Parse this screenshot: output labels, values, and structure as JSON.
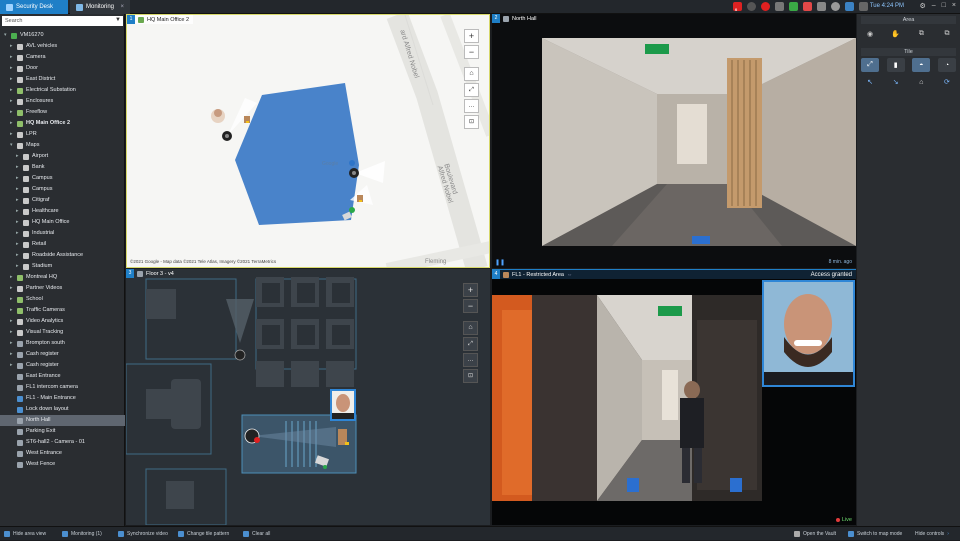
{
  "topbar": {
    "app_tab": "Security Desk",
    "monitoring_tab": "Monitoring",
    "clock": "Tue 4:24 PM",
    "tray_icons": [
      "alarm-icon",
      "clock-icon",
      "record-icon",
      "camera-icon",
      "network-icon",
      "health-icon",
      "volume-icon",
      "user-icon",
      "monitor-icon",
      "keyboard-icon",
      "settings-icon"
    ],
    "tray_badge": "0"
  },
  "sidebar": {
    "search_placeholder": "Search",
    "items": [
      {
        "label": "VM16270",
        "level": 0,
        "icon": "system-icon",
        "color": "#4caf50",
        "exp": "▾"
      },
      {
        "label": "AVL vehicles",
        "level": 1,
        "icon": "folder-icon",
        "color": "#c9c9c9",
        "exp": "▸"
      },
      {
        "label": "Camera",
        "level": 1,
        "icon": "folder-icon",
        "color": "#c9c9c9",
        "exp": "▸"
      },
      {
        "label": "Door",
        "level": 1,
        "icon": "folder-icon",
        "color": "#c9c9c9",
        "exp": "▸"
      },
      {
        "label": "East District",
        "level": 1,
        "icon": "folder-icon",
        "color": "#c9c9c9",
        "exp": "▸"
      },
      {
        "label": "Electrical Substation",
        "level": 1,
        "icon": "map-icon",
        "color": "#8fbf6a",
        "exp": "▸"
      },
      {
        "label": "Enclosures",
        "level": 1,
        "icon": "folder-icon",
        "color": "#c9c9c9",
        "exp": "▸"
      },
      {
        "label": "Freeflow",
        "level": 1,
        "icon": "map-icon",
        "color": "#8fbf6a",
        "exp": "▸"
      },
      {
        "label": "HQ Main Office 2",
        "level": 1,
        "icon": "map-icon",
        "color": "#8fbf6a",
        "exp": "▸",
        "bold": true
      },
      {
        "label": "LPR",
        "level": 1,
        "icon": "folder-icon",
        "color": "#c9c9c9",
        "exp": "▸"
      },
      {
        "label": "Maps",
        "level": 1,
        "icon": "folder-icon",
        "color": "#c9c9c9",
        "exp": "▾"
      },
      {
        "label": "Airport",
        "level": 2,
        "icon": "map-icon",
        "color": "#c9c9c9",
        "exp": "▸"
      },
      {
        "label": "Bank",
        "level": 2,
        "icon": "map-icon",
        "color": "#c9c9c9",
        "exp": "▸"
      },
      {
        "label": "Campus",
        "level": 2,
        "icon": "map-icon",
        "color": "#c9c9c9",
        "exp": "▸"
      },
      {
        "label": "Campus",
        "level": 2,
        "icon": "map-icon",
        "color": "#c9c9c9",
        "exp": "▸"
      },
      {
        "label": "Citigraf",
        "level": 2,
        "icon": "map-icon",
        "color": "#c9c9c9",
        "exp": "▸"
      },
      {
        "label": "Healthcare",
        "level": 2,
        "icon": "map-icon",
        "color": "#c9c9c9",
        "exp": "▸"
      },
      {
        "label": "HQ Main Office",
        "level": 2,
        "icon": "map-icon",
        "color": "#c9c9c9",
        "exp": "▸"
      },
      {
        "label": "Industrial",
        "level": 2,
        "icon": "map-icon",
        "color": "#c9c9c9",
        "exp": "▸"
      },
      {
        "label": "Retail",
        "level": 2,
        "icon": "map-icon",
        "color": "#c9c9c9",
        "exp": "▸"
      },
      {
        "label": "Roadside Assistance",
        "level": 2,
        "icon": "map-icon",
        "color": "#c9c9c9",
        "exp": "▸"
      },
      {
        "label": "Stadium",
        "level": 2,
        "icon": "map-icon",
        "color": "#c9c9c9",
        "exp": "▸"
      },
      {
        "label": "Montreal HQ",
        "level": 1,
        "icon": "map-icon",
        "color": "#8fbf6a",
        "exp": "▸"
      },
      {
        "label": "Partner Videos",
        "level": 1,
        "icon": "folder-icon",
        "color": "#c9c9c9",
        "exp": "▸"
      },
      {
        "label": "School",
        "level": 1,
        "icon": "map-icon",
        "color": "#8fbf6a",
        "exp": "▸"
      },
      {
        "label": "Traffic Cameras",
        "level": 1,
        "icon": "map-icon",
        "color": "#8fbf6a",
        "exp": "▸"
      },
      {
        "label": "Video Analytics",
        "level": 1,
        "icon": "folder-icon",
        "color": "#c9c9c9",
        "exp": "▸"
      },
      {
        "label": "Visual Tracking",
        "level": 1,
        "icon": "folder-icon",
        "color": "#c9c9c9",
        "exp": "▸"
      },
      {
        "label": "Brompton south",
        "level": 1,
        "icon": "camera-icon",
        "color": "#9aa3ad",
        "exp": "▸"
      },
      {
        "label": "Cash register",
        "level": 1,
        "icon": "camera-icon",
        "color": "#9aa3ad",
        "exp": "▸"
      },
      {
        "label": "Cash register",
        "level": 1,
        "icon": "camera-icon",
        "color": "#9aa3ad",
        "exp": "▸"
      },
      {
        "label": "East Entrance",
        "level": 1,
        "icon": "camera-icon",
        "color": "#9aa3ad",
        "exp": ""
      },
      {
        "label": "FL1 intercom camera",
        "level": 1,
        "icon": "camera-icon",
        "color": "#9aa3ad",
        "exp": ""
      },
      {
        "label": "FL1 - Main Entrance",
        "level": 1,
        "icon": "door-icon",
        "color": "#4b8fd0",
        "exp": ""
      },
      {
        "label": "Lock down layout",
        "level": 1,
        "icon": "layout-icon",
        "color": "#4b8fd0",
        "exp": ""
      },
      {
        "label": "North Hall",
        "level": 1,
        "icon": "camera-icon",
        "color": "#9aa3ad",
        "exp": "",
        "selected": true
      },
      {
        "label": "Parking Exit",
        "level": 1,
        "icon": "camera-icon",
        "color": "#9aa3ad",
        "exp": ""
      },
      {
        "label": "ST6-hall2 - Camera - 01",
        "level": 1,
        "icon": "camera-icon",
        "color": "#9aa3ad",
        "exp": ""
      },
      {
        "label": "West Entrance",
        "level": 1,
        "icon": "camera-icon",
        "color": "#9aa3ad",
        "exp": ""
      },
      {
        "label": "West Fence",
        "level": 1,
        "icon": "camera-icon",
        "color": "#9aa3ad",
        "exp": ""
      }
    ]
  },
  "tiles": {
    "t1": {
      "num": "1",
      "title": "HQ Main Office 2",
      "attribution": "©2021 Google - Map data ©2021 Tele Atlas, Imagery ©2021 TerraMetrics",
      "street1": "ard Alfred Nobel",
      "street2": "Boulevard Alfred Nobel",
      "street3": "Fleming",
      "google": "Google"
    },
    "t2": {
      "num": "2",
      "title": "North Hall",
      "time_ago": "8 min. ago"
    },
    "t3": {
      "num": "3",
      "title": "Floor 3 - v4"
    },
    "t4": {
      "num": "4",
      "title": "FL1 - Restricted Area",
      "status": "Access granted",
      "live": "Live"
    }
  },
  "rightpanel": {
    "area_title": "Area",
    "tile_title": "Tile"
  },
  "bottombar": {
    "hide_area": "Hide area view",
    "monitoring": "Monitoring (1)",
    "sync": "Synchronize video",
    "pattern": "Change tile pattern",
    "clear": "Clear all",
    "vault": "Open the Vault",
    "map_mode": "Switch to map mode",
    "hide_controls": "Hide controls"
  },
  "colors": {
    "accent": "#1f7fc7",
    "selected_row": "#5f6670",
    "map_polygon": "#3a78c6",
    "access_granted": "#1f7fc7",
    "live": "#6fdc6f"
  }
}
